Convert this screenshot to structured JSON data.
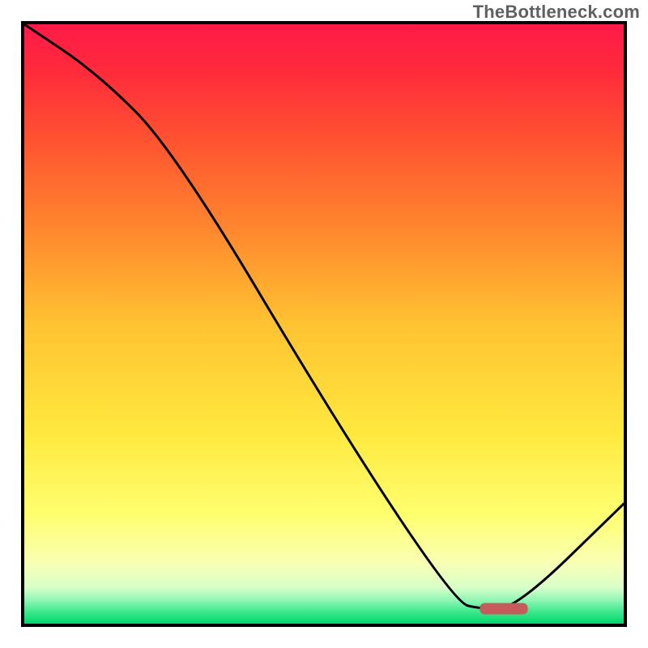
{
  "watermark": "TheBottleneck.com",
  "chart_data": {
    "type": "line",
    "title": "",
    "xlabel": "",
    "ylabel": "",
    "xlim": [
      0,
      100
    ],
    "ylim": [
      0,
      100
    ],
    "series": [
      {
        "name": "bottleneck-curve",
        "x": [
          0,
          12,
          25,
          53,
          72,
          76,
          82,
          100
        ],
        "values": [
          100,
          92,
          79,
          32,
          3.5,
          2.5,
          2.5,
          20
        ]
      }
    ],
    "marker": {
      "name": "optimum-marker",
      "x_start": 76,
      "x_end": 84,
      "y": 2.5,
      "color": "#c75a5a"
    },
    "gradient_stops": [
      {
        "offset": 0,
        "color": "#ff1a47"
      },
      {
        "offset": 8,
        "color": "#ff2b3b"
      },
      {
        "offset": 20,
        "color": "#ff5530"
      },
      {
        "offset": 35,
        "color": "#ff8a2e"
      },
      {
        "offset": 50,
        "color": "#ffc332"
      },
      {
        "offset": 68,
        "color": "#ffe83e"
      },
      {
        "offset": 82,
        "color": "#ffff70"
      },
      {
        "offset": 90,
        "color": "#f8ffb5"
      },
      {
        "offset": 94,
        "color": "#d8ffc8"
      },
      {
        "offset": 96,
        "color": "#93f7b5"
      },
      {
        "offset": 98,
        "color": "#3de88d"
      },
      {
        "offset": 100,
        "color": "#00d66a"
      }
    ]
  }
}
